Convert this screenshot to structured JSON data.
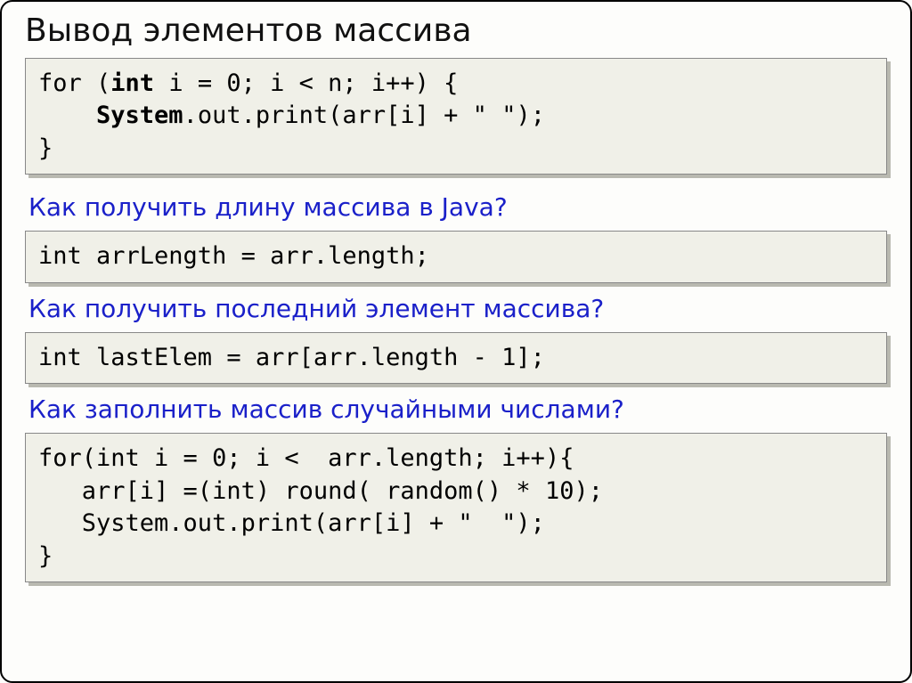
{
  "title": "Вывод элементов массива",
  "code1": {
    "l1a": "for (",
    "l1b": "int",
    "l1c": " i = 0; i < n; i++) {",
    "l2a": "    ",
    "l2b": "System",
    "l2c": ".out.print(arr[i] + \" \");",
    "l3": "}"
  },
  "q1": "Как получить длину массива в Java?",
  "code2": "int arrLength = arr.length;",
  "q2": "Как получить последний элемент массива?",
  "code3": "int lastElem = arr[arr.length - 1];",
  "q3": "Как заполнить массив случайными  числами?",
  "code4": {
    "l1": "for(int i = 0; i <  arr.length; i++){",
    "l2": "   arr[i] =(int) round( random() * 10);",
    "l3": "   System.out.print(arr[i] + \"  \");",
    "l4": "}"
  }
}
